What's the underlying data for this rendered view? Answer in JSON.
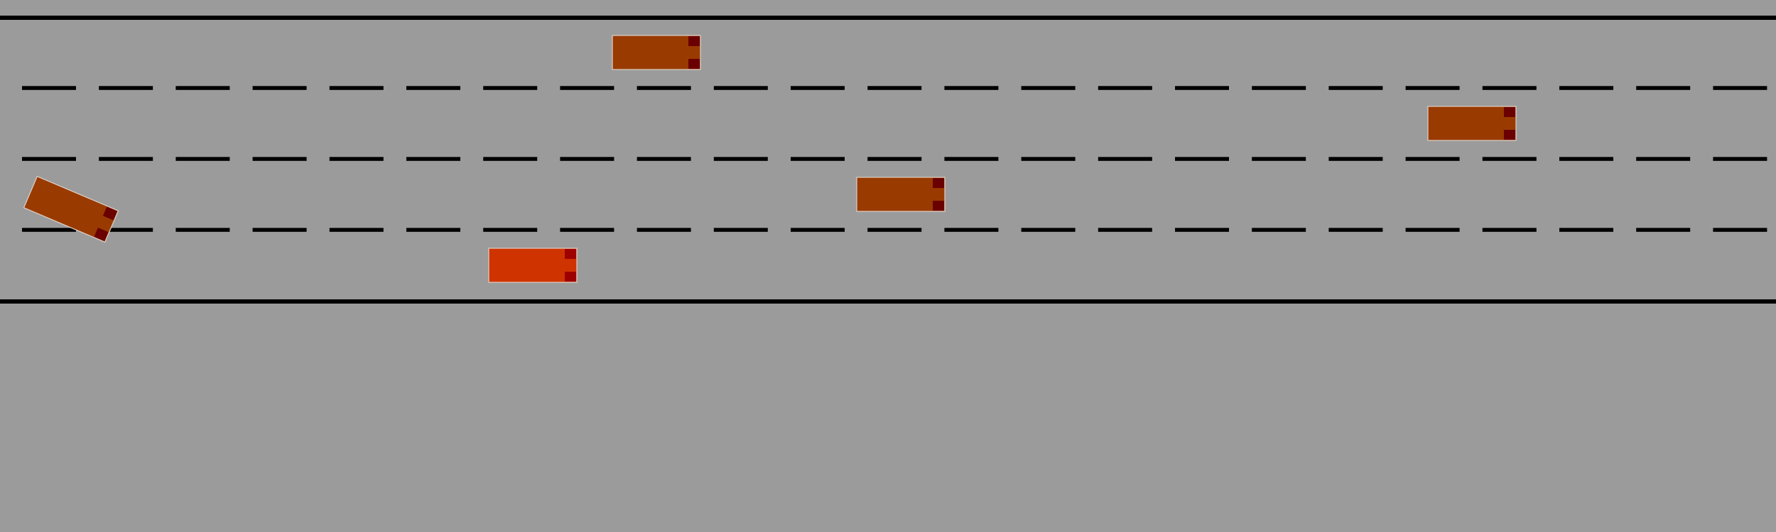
{
  "scene": {
    "type": "highway-driving",
    "lane_count": 4,
    "colors": {
      "road": "#9b9b9b",
      "boundary_line": "#000000",
      "lane_dash": "#000000",
      "ego_vehicle": "#cf3400",
      "ego_lights": "#9e0000",
      "other_vehicle": "#993b00",
      "other_lights": "#6a0000",
      "vehicle_outline": "#e0d0c8"
    },
    "ego_vehicle": {
      "name": "ego-vehicle",
      "lane": 3,
      "heading_deg": 0
    },
    "other_vehicles": [
      {
        "name": "vehicle-1",
        "lane": 0,
        "heading_deg": 0
      },
      {
        "name": "vehicle-2",
        "lane": 1,
        "heading_deg": 0
      },
      {
        "name": "vehicle-3",
        "lane": 2,
        "heading_deg": 0
      },
      {
        "name": "vehicle-4",
        "lane": 2,
        "heading_deg": 23
      }
    ]
  }
}
